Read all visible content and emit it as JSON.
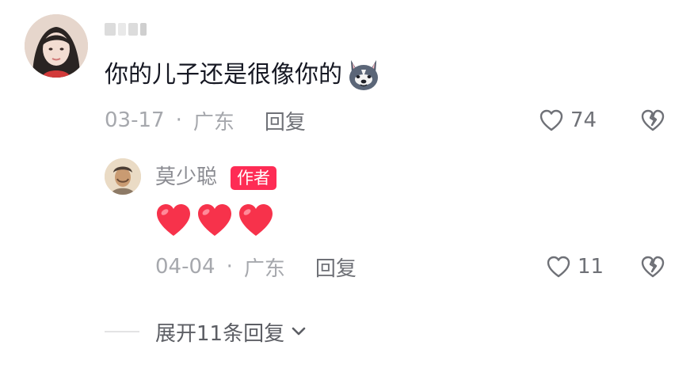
{
  "comment": {
    "text": "你的儿子还是很像你的",
    "emoji": "husky-dog-emoji",
    "date": "03-17",
    "separator": "·",
    "location": "广东",
    "reply_label": "回复",
    "like_count": "74"
  },
  "reply": {
    "author": "莫少聪",
    "badge": "作者",
    "content_emoji": [
      "red-heart-emoji",
      "red-heart-emoji",
      "red-heart-emoji"
    ],
    "date": "04-04",
    "separator": "·",
    "location": "广东",
    "reply_label": "回复",
    "like_count": "11"
  },
  "expand": {
    "label": "展开11条回复",
    "icon": "chevron-down-icon"
  },
  "colors": {
    "accent": "#fe2c55",
    "heart": "#f7324b",
    "text_primary": "#161823",
    "text_muted": "#a6a8ad",
    "text_secondary": "#6f7177"
  }
}
